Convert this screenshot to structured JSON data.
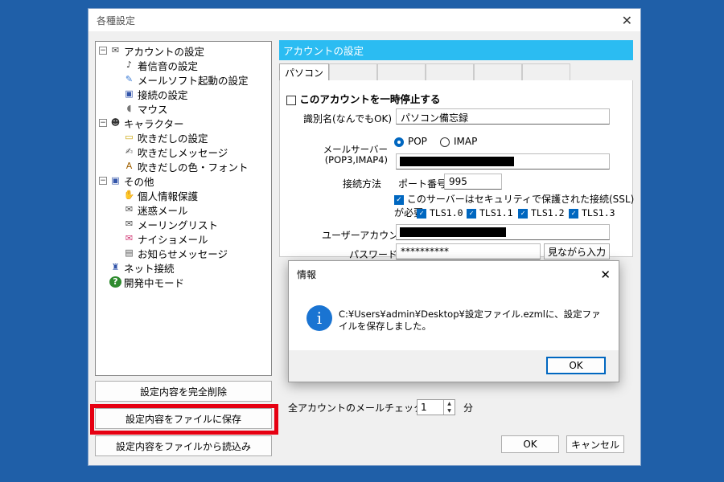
{
  "window": {
    "title": "各種設定",
    "close_glyph": "✕"
  },
  "tree": [
    {
      "label": "アカウントの設定",
      "level": 0,
      "icon": "account-icon",
      "glyph": "✉",
      "color": "#444"
    },
    {
      "label": "着信音の設定",
      "level": 1,
      "icon": "sound-icon",
      "glyph": "♪",
      "color": "#333"
    },
    {
      "label": "メールソフト起動の設定",
      "level": 1,
      "icon": "mail-launch-icon",
      "glyph": "✎",
      "color": "#3a7bd5"
    },
    {
      "label": "接続の設定",
      "level": 1,
      "icon": "connection-icon",
      "glyph": "▣",
      "color": "#3355aa"
    },
    {
      "label": "マウス",
      "level": 1,
      "icon": "mouse-icon",
      "glyph": "◖",
      "color": "#777"
    },
    {
      "label": "キャラクター",
      "level": 0,
      "icon": "character-icon",
      "glyph": "☻",
      "color": "#333"
    },
    {
      "label": "吹きだしの設定",
      "level": 1,
      "icon": "balloon-icon",
      "glyph": "▭",
      "color": "#c9a200"
    },
    {
      "label": "吹きだしメッセージ",
      "level": 1,
      "icon": "balloon-message-icon",
      "glyph": "✍",
      "color": "#555"
    },
    {
      "label": "吹きだしの色・フォント",
      "level": 1,
      "icon": "font-icon",
      "glyph": "A",
      "color": "#a06000"
    },
    {
      "label": "その他",
      "level": 0,
      "icon": "other-icon",
      "glyph": "▣",
      "color": "#3355aa"
    },
    {
      "label": "個人情報保護",
      "level": 1,
      "icon": "privacy-icon",
      "glyph": "✋",
      "color": "#a07000"
    },
    {
      "label": "迷惑メール",
      "level": 1,
      "icon": "spam-icon",
      "glyph": "✉",
      "color": "#444"
    },
    {
      "label": "メーリングリスト",
      "level": 1,
      "icon": "mailing-list-icon",
      "glyph": "✉",
      "color": "#444"
    },
    {
      "label": "ナイショメール",
      "level": 1,
      "icon": "secret-mail-icon",
      "glyph": "✉",
      "color": "#d0306f"
    },
    {
      "label": "お知らせメッセージ",
      "level": 1,
      "icon": "notice-icon",
      "glyph": "▤",
      "color": "#555"
    },
    {
      "label": "ネット接続",
      "level": 0,
      "icon": "network-icon",
      "glyph": "♜",
      "color": "#3355aa",
      "noexp": true
    },
    {
      "label": "開発中モード",
      "level": 0,
      "icon": "help-icon",
      "glyph": "?",
      "color": "#fff",
      "bg": "#2e8b2e",
      "noexp": true
    }
  ],
  "left_buttons": {
    "delete_all": "設定内容を完全削除",
    "save_file": "設定内容をファイルに保存",
    "load_file": "設定内容をファイルから読込み"
  },
  "panel": {
    "header": "アカウントの設定",
    "active_tab": "パソコン",
    "pause_label": "このアカウントを一時停止する",
    "nickname_label": "識別名(なんでもOK)",
    "nickname_value": "パソコン備忘録",
    "server_label_1": "メールサーバー",
    "server_label_2": "(POP3,IMAP4)",
    "protocol_pop": "POP",
    "protocol_imap": "IMAP",
    "connection_label": "接続方法",
    "port_label": "ポート番号",
    "port_value": "995",
    "ssl_label": "このサーバーはセキュリティで保護された接続(SSL)が必要",
    "tls": [
      "TLS1.0",
      "TLS1.1",
      "TLS1.2",
      "TLS1.3"
    ],
    "user_label": "ユーザーアカウント",
    "password_label": "パスワード",
    "password_value": "**********",
    "show_password": "見ながら入力"
  },
  "interval": {
    "label": "全アカウントのメールチェック間隔",
    "value": "1",
    "unit": "分"
  },
  "footer": {
    "ok": "OK",
    "cancel": "キャンセル"
  },
  "dialog": {
    "title": "情報",
    "close_glyph": "✕",
    "info_glyph": "i",
    "message": "C:¥Users¥admin¥Desktop¥設定ファイル.ezmlに、設定ファイルを保存しました。",
    "ok": "OK"
  }
}
